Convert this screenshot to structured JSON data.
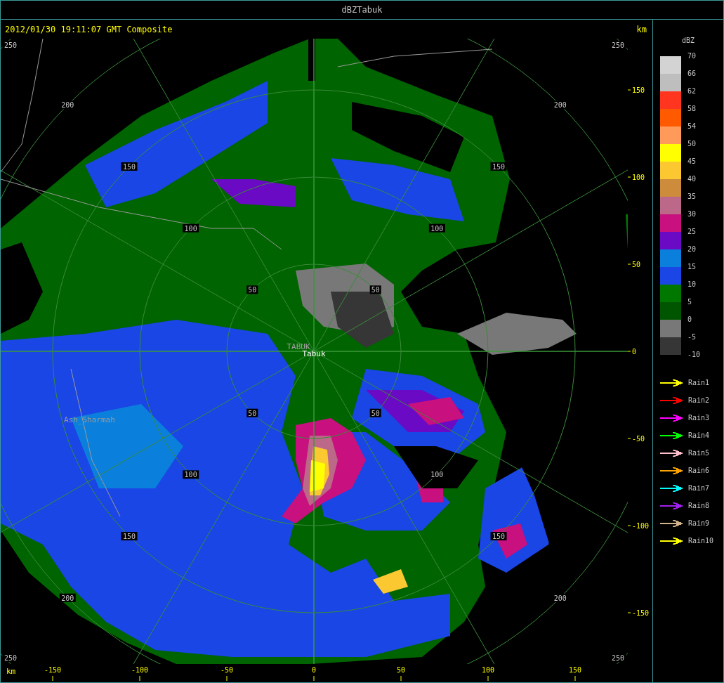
{
  "window": {
    "title": "dBZTabuk"
  },
  "map": {
    "timestamp": "2012/01/30 19:11:07 GMT Composite",
    "unit_top": "km",
    "unit_bottom": "km",
    "y_ticks": [
      "150",
      "100",
      "50",
      "0",
      "-50",
      "-100",
      "-150"
    ],
    "x_ticks": [
      "-150",
      "-100",
      "-50",
      "0",
      "50",
      "100",
      "150"
    ],
    "rings": [
      {
        "labels": [
          "50",
          "50",
          "50",
          "50"
        ]
      },
      {
        "labels": [
          "100",
          "100",
          "100",
          "100"
        ]
      },
      {
        "labels": [
          "150",
          "150",
          "150",
          "150"
        ]
      },
      {
        "labels": [
          "200",
          "200",
          "200",
          "200"
        ]
      },
      {
        "labels": [
          "250",
          "250",
          "250",
          "250"
        ]
      }
    ],
    "places": [
      {
        "name": "TABUK",
        "kind": "faded"
      },
      {
        "name": "Tabuk",
        "kind": "site"
      },
      {
        "name": "Ash_Sharmah",
        "kind": "city"
      }
    ]
  },
  "legend": {
    "title": "dBZ",
    "ticks": [
      "70",
      "66",
      "62",
      "58",
      "54",
      "50",
      "45",
      "40",
      "35",
      "30",
      "25",
      "20",
      "15",
      "10",
      "5",
      "0",
      "-5",
      "-10"
    ],
    "bins": [
      {
        "color": "#d3d3d3"
      },
      {
        "color": "#bebebe"
      },
      {
        "color": "#ff3520"
      },
      {
        "color": "#ff5a00"
      },
      {
        "color": "#ff9a5a"
      },
      {
        "color": "#ffff00"
      },
      {
        "color": "#fbc832"
      },
      {
        "color": "#cd8b3c"
      },
      {
        "color": "#bb6889"
      },
      {
        "color": "#c8107e"
      },
      {
        "color": "#6a0ac4"
      },
      {
        "color": "#0a80dc"
      },
      {
        "color": "#1a46e6"
      },
      {
        "color": "#007800"
      },
      {
        "color": "#005500"
      },
      {
        "color": "#787878"
      },
      {
        "color": "#363636"
      }
    ]
  },
  "tracks": [
    {
      "label": "Rain1",
      "color": "#ffff00"
    },
    {
      "label": "Rain2",
      "color": "#ff0000"
    },
    {
      "label": "Rain3",
      "color": "#ff00ff"
    },
    {
      "label": "Rain4",
      "color": "#00ff00"
    },
    {
      "label": "Rain5",
      "color": "#ffc0cb"
    },
    {
      "label": "Rain6",
      "color": "#ffa500"
    },
    {
      "label": "Rain7",
      "color": "#00ffff"
    },
    {
      "label": "Rain8",
      "color": "#a020f0"
    },
    {
      "label": "Rain9",
      "color": "#d2b48c"
    },
    {
      "label": "Rain10",
      "color": "#ffff00"
    }
  ]
}
